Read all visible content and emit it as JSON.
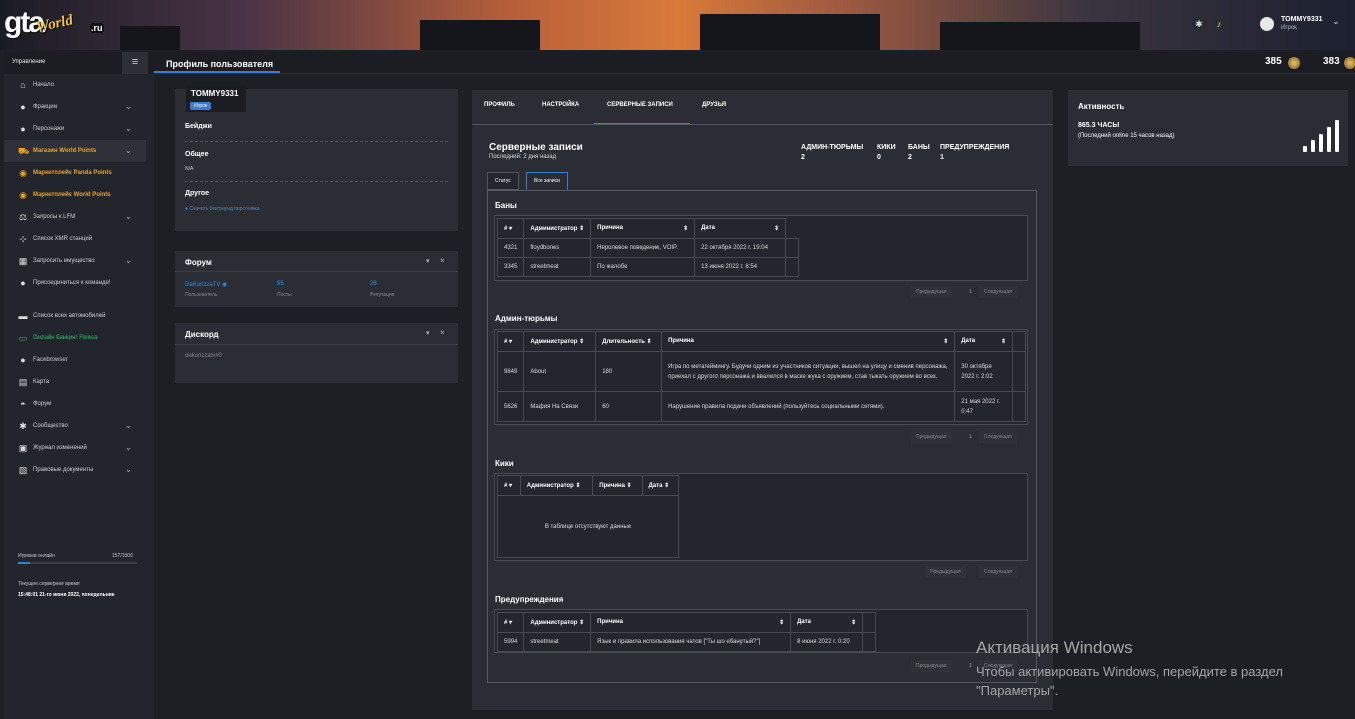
{
  "header": {
    "logo_text": "gta",
    "logo_sub": "World",
    "logo_tld": ".ru",
    "settings_icon": "gear-icon",
    "notifications_icon": "bell-icon",
    "user_name": "TOMMY9331",
    "user_role": "Игрок"
  },
  "sidebar": {
    "title": "Управление",
    "items": [
      {
        "label": "Начало",
        "icon": "home-icon"
      },
      {
        "label": "Фракции",
        "icon": "group-icon"
      },
      {
        "label": "Персонажи",
        "icon": "user-icon"
      },
      {
        "label": "Магазин World Points",
        "icon": "cart-icon"
      },
      {
        "label": "Маркетплейс Panda Points",
        "icon": "coins-icon"
      },
      {
        "label": "Маркетплейс World Points",
        "icon": "coins-icon"
      },
      {
        "label": "Запросы к LFM",
        "icon": "scale-icon"
      },
      {
        "label": "Список XMR станций",
        "icon": "antenna-icon"
      },
      {
        "label": "Запросить имущество",
        "icon": "building-icon"
      },
      {
        "label": "Присоединиться к команде!",
        "icon": "user-plus-icon"
      },
      {
        "label": "Список всех автомобилей",
        "icon": "car-icon"
      },
      {
        "label": "Онлайн банкинг Fleeca",
        "icon": "bank-icon"
      },
      {
        "label": "Facebrowser",
        "icon": "people-icon"
      },
      {
        "label": "Карта",
        "icon": "map-icon"
      },
      {
        "label": "Форум",
        "icon": "chat-icon"
      },
      {
        "label": "Сообщество",
        "icon": "gear-icon"
      },
      {
        "label": "Журнал изменений",
        "icon": "book-icon"
      },
      {
        "label": "Правовые документы",
        "icon": "document-icon"
      }
    ],
    "online_label": "Игроков онлайн",
    "online_value": "157/1500",
    "online_fraction": 0.105,
    "time_label": "Текущее серверное время",
    "time_value": "15:48:01 21-го июня 2022, понедельник"
  },
  "subbar": {
    "page_title": "Профиль пользователя",
    "points_1": "385",
    "points_2": "383"
  },
  "profile": {
    "name": "TOMMY9331",
    "role_badge": "Игрок",
    "badges_label": "Бейджи",
    "general_label": "Общее",
    "general_value": "N/A",
    "other_label": "Другое",
    "download_link": "Скачать бекграунд персонажа"
  },
  "forum": {
    "title": "Форум",
    "username": "DaKurizzaTV",
    "user_label": "Пользователь",
    "posts": "55",
    "posts_label": "Посты",
    "reputation": "28",
    "reputation_label": "Репутация"
  },
  "discord": {
    "title": "Дискорд",
    "value": "dakurizzatv#0"
  },
  "tabs": [
    "ПРОФИЛЬ",
    "НАСТРОЙКА",
    "СЕРВЕРНЫЕ ЗАПИСИ",
    "ДРУЗЬЯ"
  ],
  "records": {
    "title": "Серверные записи",
    "subtitle": "Последний: 2 дня назад",
    "stats": [
      {
        "label": "АДМИН-ТЮРЬМЫ",
        "value": "2"
      },
      {
        "label": "КИКИ",
        "value": "0"
      },
      {
        "label": "БАНЫ",
        "value": "2"
      },
      {
        "label": "ПРЕДУПРЕЖДЕНИЯ",
        "value": "1"
      }
    ],
    "btn_status": "Статус",
    "btn_all": "Все записи",
    "pager_prev": "Предыдущая",
    "pager_page": "1",
    "pager_next": "Следующая",
    "bans": {
      "title": "Баны",
      "headers": [
        "#",
        "Администратор",
        "Причина",
        "Дата"
      ],
      "rows": [
        [
          "4321",
          "floydbones",
          "Неролевое поведение, VOIP.",
          "22 октября 2022 г. 19:04"
        ],
        [
          "3345",
          "streetmeat",
          "По жалобе",
          "13 июня 2022 г. 8:54"
        ]
      ]
    },
    "jails": {
      "title": "Админ-тюрьмы",
      "headers": [
        "#",
        "Администратор",
        "Длительность",
        "Причина",
        "Дата"
      ],
      "rows": [
        [
          "9849",
          "About",
          "180",
          "Игра по метагеймингу. Будучи одним из участников ситуации, вышел на улицу и сменив персонажа, приехал с другого персонажа и ввалился в маске жука с оружием, став тыкать оружием во всех.",
          "30 октября 2022 г. 2:02"
        ],
        [
          "5626",
          "Мафия На Связи",
          "60",
          "Нарушение правила подачи объявлений (пользуйтесь социальными сетями).",
          "21 мая 2022 г. 0:47"
        ]
      ]
    },
    "kicks": {
      "title": "Кики",
      "headers": [
        "#",
        "Администратор",
        "Причина",
        "Дата"
      ],
      "empty": "В таблице отсутствуют данные"
    },
    "warnings": {
      "title": "Предупреждения",
      "headers": [
        "#",
        "Администратор",
        "Причина",
        "Дата"
      ],
      "rows": [
        [
          "5994",
          "streetmeat",
          "Язык и правила использования чатов [\"Ты шо ебанутый?\"]",
          "8 июня 2022 г. 0:20"
        ]
      ]
    }
  },
  "activity": {
    "title": "Активность",
    "hours": "865.3 ЧАСЫ",
    "last_online": "(Последний online 15 часов назад)",
    "icon": "signal-bars-icon"
  },
  "watermark": {
    "title": "Активация Windows",
    "text": "Чтобы активировать Windows, перейдите в раздел \"Параметры\"."
  }
}
